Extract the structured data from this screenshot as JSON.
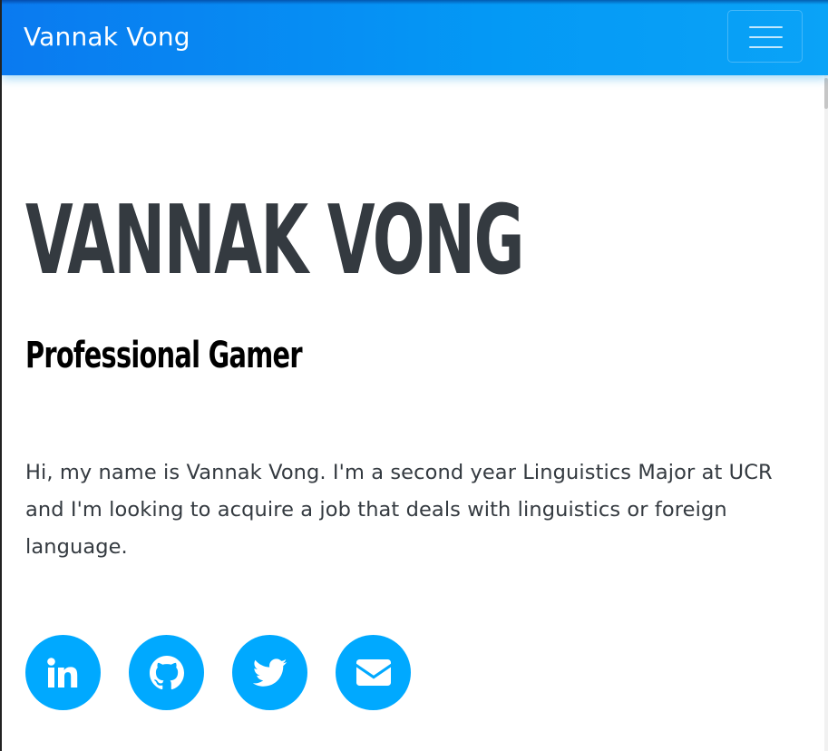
{
  "navbar": {
    "brand": "Vannak Vong",
    "toggler_icon": "hamburger-menu-icon"
  },
  "hero": {
    "name": "VANNAK VONG",
    "subtitle": "Professional Gamer",
    "bio": "Hi, my name is Vannak Vong. I'm a second year Linguistics Major at UCR and I'm looking to acquire a job that deals with linguistics or foreign language."
  },
  "social_links": [
    {
      "icon": "linkedin-icon"
    },
    {
      "icon": "github-icon"
    },
    {
      "icon": "twitter-icon"
    },
    {
      "icon": "envelope-icon"
    }
  ],
  "colors": {
    "navbar_start": "#0a7af0",
    "navbar_end": "#0aa3f7",
    "social_circle": "#00a9ff",
    "heading_text": "#343a40"
  }
}
